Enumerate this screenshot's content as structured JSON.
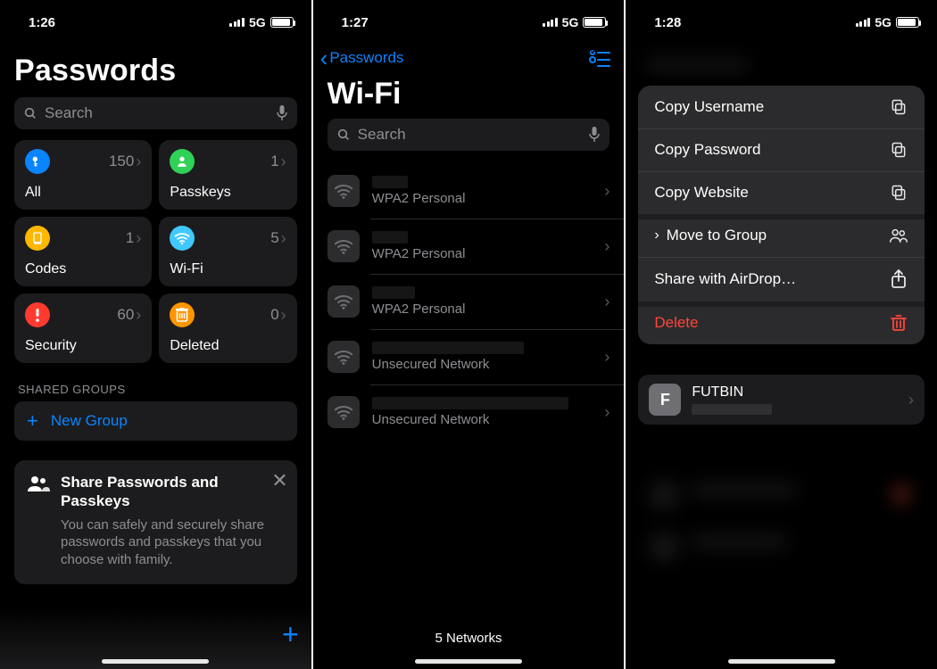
{
  "screens": [
    {
      "status": {
        "time": "1:26",
        "network": "5G"
      },
      "title": "Passwords",
      "search_placeholder": "Search",
      "tiles": [
        {
          "key": "all",
          "label": "All",
          "count": "150",
          "color": "#0a84ff"
        },
        {
          "key": "passkeys",
          "label": "Passkeys",
          "count": "1",
          "color": "#30d158"
        },
        {
          "key": "codes",
          "label": "Codes",
          "count": "1",
          "color": "#ffb800"
        },
        {
          "key": "wifi",
          "label": "Wi-Fi",
          "count": "5",
          "color": "#40c8ff"
        },
        {
          "key": "security",
          "label": "Security",
          "count": "60",
          "color": "#ff3b30"
        },
        {
          "key": "deleted",
          "label": "Deleted",
          "count": "0",
          "color": "#ff9500"
        }
      ],
      "shared_groups_header": "SHARED GROUPS",
      "new_group_label": "New Group",
      "share_card": {
        "title": "Share Passwords and Passkeys",
        "body": "You can safely and securely share passwords and passkeys that you choose with family."
      }
    },
    {
      "status": {
        "time": "1:27",
        "network": "5G"
      },
      "back_label": "Passwords",
      "title": "Wi-Fi",
      "search_placeholder": "Search",
      "networks": [
        {
          "security": "WPA2 Personal",
          "ssid_redact_w": 40
        },
        {
          "security": "WPA2 Personal",
          "ssid_redact_w": 40
        },
        {
          "security": "WPA2 Personal",
          "ssid_redact_w": 48
        },
        {
          "security": "Unsecured Network",
          "ssid_redact_w": 170
        },
        {
          "security": "Unsecured Network",
          "ssid_redact_w": 220
        }
      ],
      "footer": "5 Networks"
    },
    {
      "status": {
        "time": "1:28",
        "network": "5G"
      },
      "context_menu": [
        {
          "label": "Copy Username",
          "icon": "copy",
          "kind": "normal"
        },
        {
          "label": "Copy Password",
          "icon": "copy",
          "kind": "normal"
        },
        {
          "label": "Copy Website",
          "icon": "copy",
          "kind": "normal"
        },
        {
          "label": "Move to Group",
          "icon": "people",
          "kind": "submenu"
        },
        {
          "label": "Share with AirDrop…",
          "icon": "share",
          "kind": "normal"
        },
        {
          "label": "Delete",
          "icon": "trash",
          "kind": "danger"
        }
      ],
      "focused_item": {
        "initial": "F",
        "title": "FUTBIN"
      }
    }
  ]
}
